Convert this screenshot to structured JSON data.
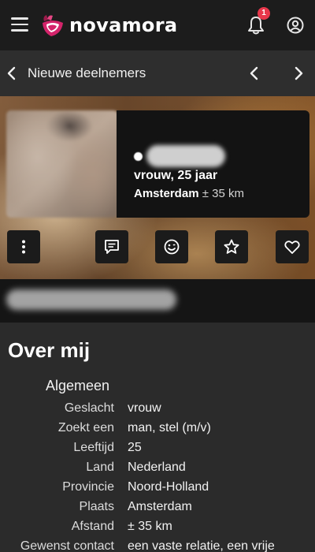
{
  "header": {
    "logo_text": "novamora",
    "notification_count": "1"
  },
  "nav": {
    "title": "Nieuwe deelnemers"
  },
  "profile": {
    "gender_age": "vrouw, 25 jaar",
    "city": "Amsterdam",
    "distance": " ± 35 km"
  },
  "about": {
    "title": "Over mij",
    "section": "Algemeen",
    "rows": [
      {
        "label": "Geslacht",
        "value": "vrouw"
      },
      {
        "label": "Zoekt een",
        "value": "man, stel (m/v)"
      },
      {
        "label": "Leeftijd",
        "value": "25"
      },
      {
        "label": "Land",
        "value": "Nederland"
      },
      {
        "label": "Provincie",
        "value": "Noord-Holland"
      },
      {
        "label": "Plaats",
        "value": "Amsterdam"
      },
      {
        "label": "Afstand",
        "value": "± 35 km"
      },
      {
        "label": "Gewenst contact",
        "value": "een vaste relatie, een vrije"
      }
    ]
  },
  "colors": {
    "accent": "#e8374b",
    "brand_pink": "#d4246b",
    "background": "#2b2b2b"
  },
  "icons": [
    "menu-icon",
    "logo-icon",
    "bell-icon",
    "user-circle-icon",
    "chevron-left-icon",
    "chevron-right-icon",
    "more-vertical-icon",
    "message-icon",
    "smiley-icon",
    "star-icon",
    "heart-icon"
  ]
}
